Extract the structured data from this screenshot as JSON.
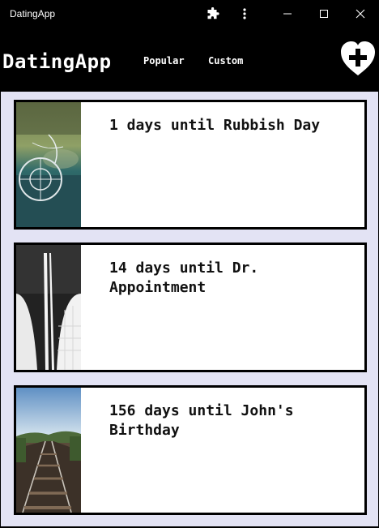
{
  "window": {
    "title": "DatingApp",
    "icons": [
      "extension-icon",
      "more-vertical-icon",
      "minimize-icon",
      "maximize-icon",
      "close-icon"
    ]
  },
  "appbar": {
    "brand": "DatingApp",
    "nav": [
      "Popular",
      "Custom"
    ],
    "add_icon": "heart-plus-icon"
  },
  "colors": {
    "background": "#e3e3f4",
    "header": "#000000",
    "card": "#ffffff",
    "card_border": "#000000"
  },
  "events": [
    {
      "text": "1 days until Rubbish Day",
      "image": "car-dashboard-photo"
    },
    {
      "text": "14 days until Dr. Appointment",
      "image": "architecture-photo"
    },
    {
      "text": "156 days until John's Birthday",
      "image": "railway-tracks-photo"
    }
  ]
}
